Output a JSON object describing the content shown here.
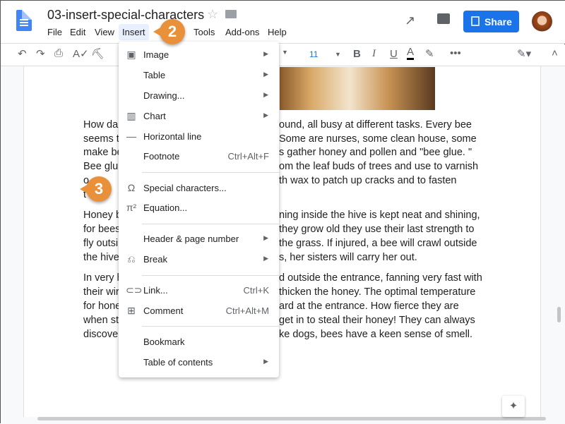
{
  "header": {
    "title": "03-insert-special-characters",
    "menus": [
      "File",
      "Edit",
      "View",
      "Insert",
      "Tools",
      "Add-ons",
      "Help"
    ],
    "share_label": "Share"
  },
  "toolbar": {
    "font_size": "11",
    "more": "•••"
  },
  "document": {
    "lines": [
      {
        "left": "How da",
        "right": "ound, all busy at different tasks. Every bee"
      },
      {
        "left": "seems t",
        "right": "Some are nurses, some clean house, some"
      },
      {
        "left": "make be",
        "right": "s gather honey and pollen and \"bee glue. \""
      },
      {
        "left": "Bee glu",
        "right": "om the leaf buds of trees and use to varnish"
      },
      {
        "left": "o",
        "right": "th wax to patch up cracks and to fasten"
      },
      {
        "left": "t",
        "right": ""
      },
      {
        "left": "Honey b",
        "right": "ning inside the hive is kept neat and shining,"
      },
      {
        "left": "for bees",
        "right": "they grow old they use their last strength to"
      },
      {
        "left": "fly outsi",
        "right": "the grass. If injured, a bee will crawl outside"
      },
      {
        "left": "the hive",
        "right": "s, her sisters will carry her out."
      },
      {
        "left": "In very h",
        "right": "d outside the entrance, fanning very fast with"
      },
      {
        "left": "their wir",
        "right": "thicken the honey. The optimal temperature"
      },
      {
        "left": "for hone",
        "right": "ard at the entrance. How fierce they are"
      },
      {
        "left": "when st",
        "right": "get in to steal their honey! They can always"
      },
      {
        "left": "discove",
        "right": "ke dogs, bees have a keen sense of smell."
      }
    ]
  },
  "insert_menu": {
    "items": [
      {
        "label": "Image",
        "icon": "image-icon",
        "submenu": true
      },
      {
        "label": "Table",
        "submenu": true
      },
      {
        "label": "Drawing...",
        "submenu": true
      },
      {
        "label": "Chart",
        "icon": "chart-icon",
        "submenu": true
      },
      {
        "label": "Horizontal line",
        "icon": "horizontal-line-icon"
      },
      {
        "label": "Footnote",
        "shortcut": "Ctrl+Alt+F"
      },
      {
        "label": "Special characters...",
        "icon": "omega-icon"
      },
      {
        "label": "Equation...",
        "icon": "pi-icon"
      },
      {
        "label": "Header & page number",
        "submenu": true
      },
      {
        "label": "Break",
        "icon": "break-icon",
        "submenu": true
      },
      {
        "label": "Link...",
        "icon": "link-icon",
        "shortcut": "Ctrl+K"
      },
      {
        "label": "Comment",
        "icon": "comment-icon",
        "shortcut": "Ctrl+Alt+M"
      },
      {
        "label": "Bookmark"
      },
      {
        "label": "Table of contents",
        "submenu": true
      }
    ]
  },
  "callouts": [
    "2",
    "3"
  ],
  "colors": {
    "accent": "#1a73e8",
    "callout": "#e8913a",
    "menu_highlight": "#e8f0fe"
  }
}
